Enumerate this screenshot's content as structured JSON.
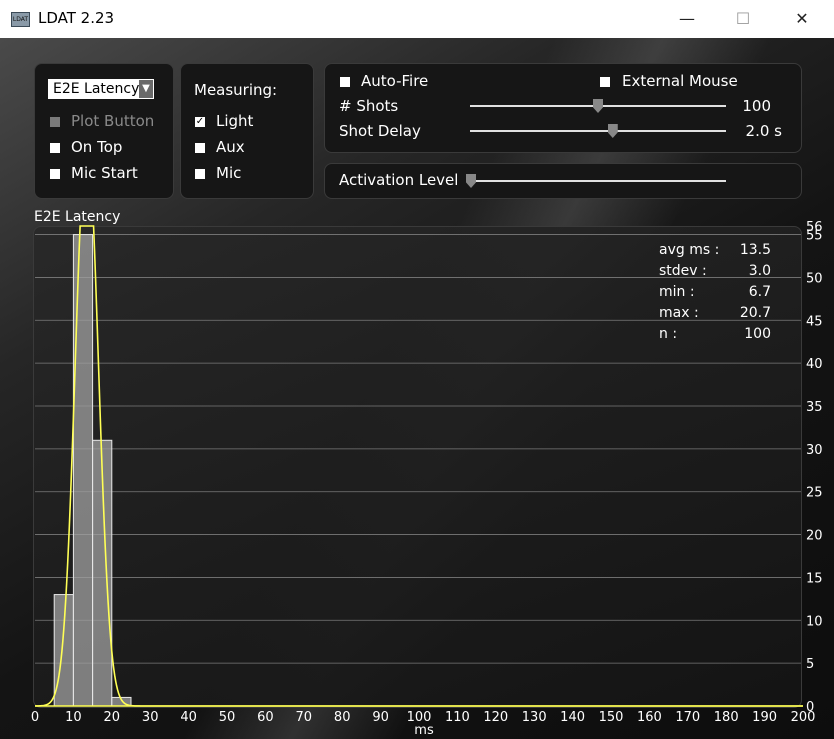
{
  "window": {
    "title": "LDAT 2.23",
    "icon_text": "LDAT",
    "minimize_glyph": "—",
    "maximize_glyph": "☐",
    "close_glyph": "✕"
  },
  "options": {
    "mode_select": "E2E Latency",
    "plot_button": "Plot Button",
    "on_top": "On Top",
    "mic_start": "Mic Start"
  },
  "measuring": {
    "heading": "Measuring:",
    "light": "Light",
    "aux": "Aux",
    "mic": "Mic",
    "light_checked": true
  },
  "shots": {
    "auto_fire": "Auto-Fire",
    "external_mouse": "External Mouse",
    "shots_label": "# Shots",
    "shots_value": "100",
    "shot_delay_label": "Shot Delay",
    "shot_delay_value": "2.0 s",
    "shots_level": 0.5,
    "delay_level": 0.56
  },
  "activation": {
    "label": "Activation Level",
    "level": 0.0
  },
  "stats": [
    {
      "key": "avg ms :",
      "value": "13.5"
    },
    {
      "key": "stdev :",
      "value": "3.0"
    },
    {
      "key": "min :",
      "value": "6.7"
    },
    {
      "key": "max :",
      "value": "20.7"
    },
    {
      "key": "n :",
      "value": "100"
    }
  ],
  "chart_data": {
    "type": "bar",
    "title": "E2E Latency",
    "xlabel": "ms",
    "ylabel": "",
    "xlim": [
      0,
      200
    ],
    "ylim": [
      0,
      56
    ],
    "x_ticks": [
      0,
      10,
      20,
      30,
      40,
      50,
      60,
      70,
      80,
      90,
      100,
      110,
      120,
      130,
      140,
      150,
      160,
      170,
      180,
      190,
      200
    ],
    "y_ticks": [
      0,
      5,
      10,
      15,
      20,
      25,
      30,
      35,
      40,
      45,
      50,
      55,
      56
    ],
    "grid": true,
    "bin_width": 5,
    "bins": [
      {
        "start": 5,
        "count": 13
      },
      {
        "start": 10,
        "count": 55
      },
      {
        "start": 15,
        "count": 31
      },
      {
        "start": 20,
        "count": 1
      }
    ],
    "fit": {
      "type": "normal",
      "mean": 13.5,
      "stdev": 3.0,
      "n": 100
    },
    "colors": {
      "bars": "#a0a0a0",
      "fit_line": "#ffff55",
      "grid": "#9a9a9a",
      "axis": "#ffff55"
    }
  }
}
